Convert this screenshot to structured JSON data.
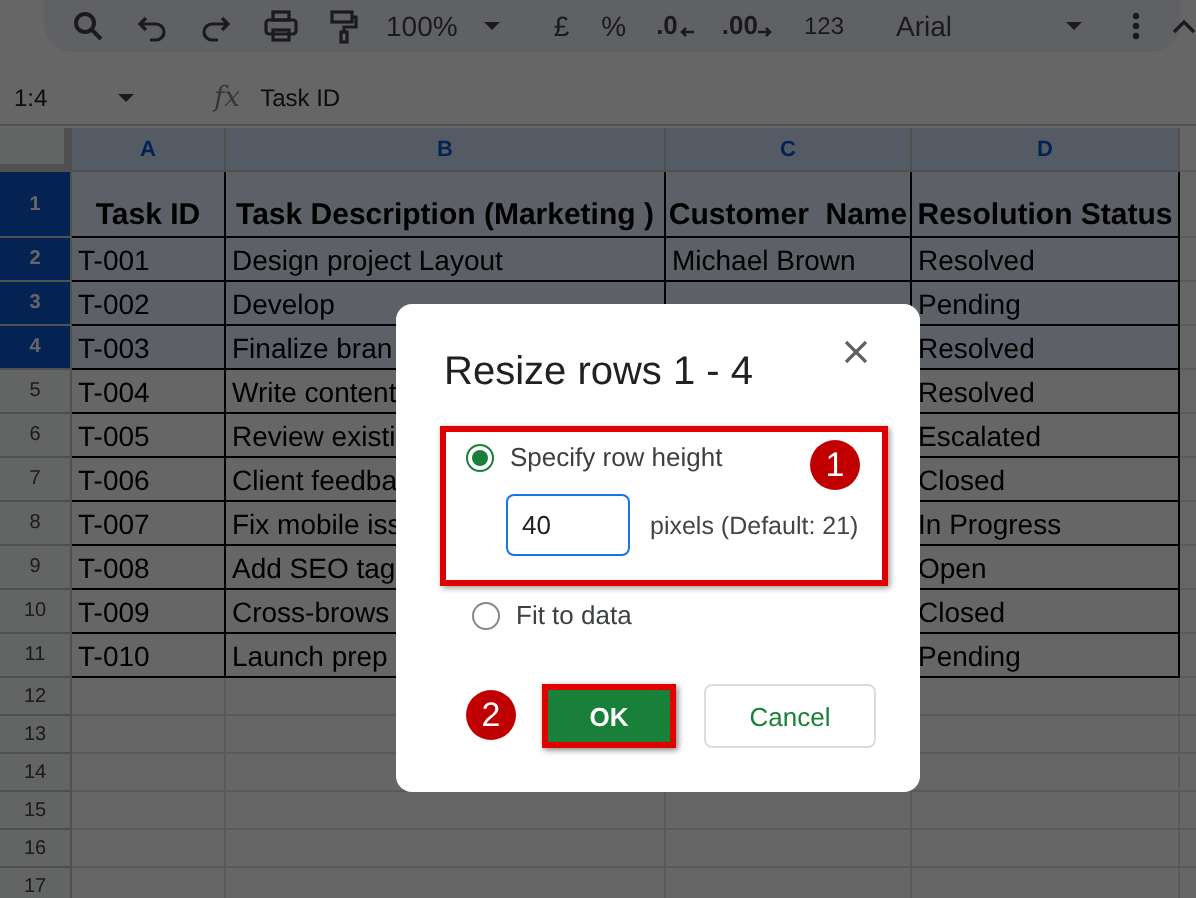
{
  "toolbar": {
    "zoom": "100%",
    "items": [
      "£",
      "%",
      ".0",
      ".00",
      "123"
    ],
    "font": "Arial"
  },
  "formula_bar": {
    "name_box": "1:4",
    "fx": "fx",
    "value": "Task ID"
  },
  "sheet": {
    "columns": [
      {
        "label": "A",
        "selected": true
      },
      {
        "label": "B",
        "selected": true
      },
      {
        "label": "C",
        "selected": true
      },
      {
        "label": "D",
        "selected": true
      }
    ],
    "rows": [
      {
        "number": "1",
        "selected": true,
        "cells": [
          "Task ID",
          "Task Description (Marketing )",
          "Customer  Name",
          "Resolution Status"
        ]
      },
      {
        "number": "2",
        "selected": true,
        "cells": [
          "T-001",
          "Design project Layout",
          "Michael Brown",
          "Resolved"
        ]
      },
      {
        "number": "3",
        "selected": true,
        "cells": [
          "T-002",
          "Develop",
          "",
          "Pending"
        ]
      },
      {
        "number": "4",
        "selected": true,
        "cells": [
          "T-003",
          "Finalize bran",
          "",
          "Resolved"
        ]
      },
      {
        "number": "5",
        "selected": false,
        "cells": [
          "T-004",
          "Write content",
          "",
          "Resolved"
        ]
      },
      {
        "number": "6",
        "selected": false,
        "cells": [
          "T-005",
          "Review existi",
          "",
          "Escalated"
        ]
      },
      {
        "number": "7",
        "selected": false,
        "cells": [
          "T-006",
          "Client feedba",
          "",
          "Closed"
        ]
      },
      {
        "number": "8",
        "selected": false,
        "cells": [
          "T-007",
          "Fix mobile iss",
          "",
          "In Progress"
        ]
      },
      {
        "number": "9",
        "selected": false,
        "cells": [
          "T-008",
          "Add SEO tag",
          "",
          "Open"
        ]
      },
      {
        "number": "10",
        "selected": false,
        "cells": [
          "T-009",
          "Cross-brows",
          "",
          "Closed"
        ]
      },
      {
        "number": "11",
        "selected": false,
        "cells": [
          "T-010",
          "Launch prep",
          "",
          "Pending"
        ]
      }
    ],
    "empty_rows": [
      "12",
      "13",
      "14",
      "15",
      "16",
      "17"
    ]
  },
  "dialog": {
    "title": "Resize rows 1 - 4",
    "options": [
      {
        "label": "Specify row height",
        "selected": true
      },
      {
        "label": "Fit to data",
        "selected": false
      }
    ],
    "height_field": {
      "value": "40",
      "unit": "pixels (Default: 21)"
    },
    "buttons": [
      {
        "label": "OK",
        "kind": "primary"
      },
      {
        "label": "Cancel",
        "kind": "secondary"
      }
    ],
    "callouts": [
      "1",
      "2"
    ]
  }
}
